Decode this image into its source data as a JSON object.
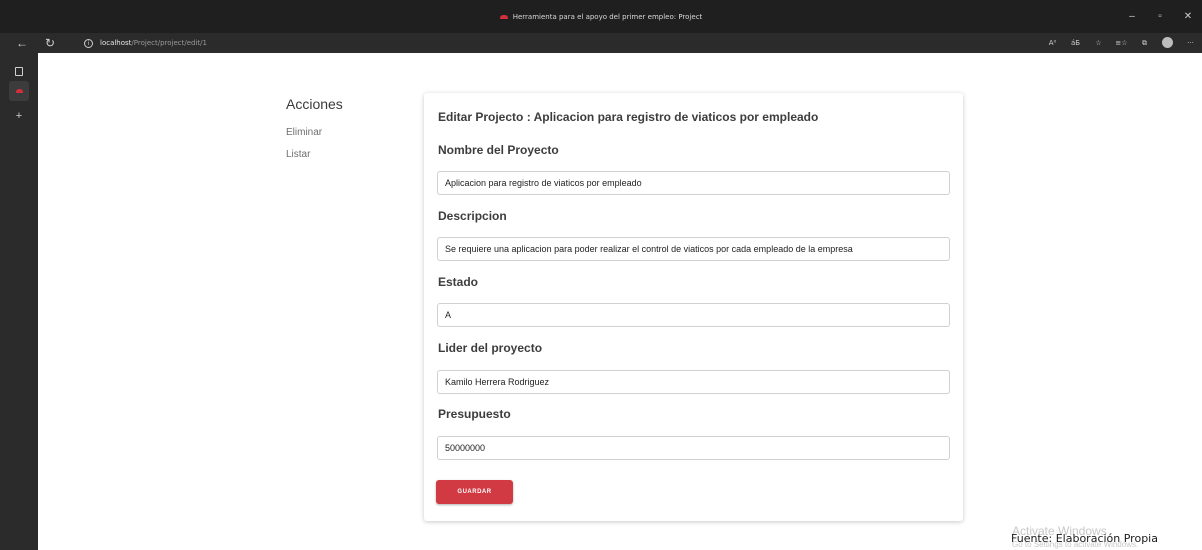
{
  "window": {
    "title": "Herramienta para el apoyo del primer empleo: Project",
    "controls": [
      "–",
      "▫",
      "✕"
    ]
  },
  "addressbar": {
    "back_icon": "←",
    "refresh_icon": "↻",
    "url_host": "localhost",
    "url_path": "/Project/project/edit/1",
    "tool_icons": [
      "A⁰",
      "áБ",
      "☆",
      "≡☆",
      "⧉"
    ],
    "more_icon": "···"
  },
  "sidebar": {
    "add_icon": "+"
  },
  "actions": {
    "title": "Acciones",
    "links": [
      "Eliminar",
      "Listar"
    ]
  },
  "form": {
    "title": "Editar Projecto : Aplicacion para registro de viaticos por empleado",
    "fields": [
      {
        "label": "Nombre del Proyecto",
        "value": "Aplicacion para registro de viaticos por empleado"
      },
      {
        "label": "Descripcion",
        "value": "Se requiere una aplicacion para poder realizar el control de viaticos por cada empleado de la empresa"
      },
      {
        "label": "Estado",
        "value": "A"
      },
      {
        "label": "Lider del proyecto",
        "value": "Kamilo Herrera Rodriguez"
      },
      {
        "label": "Presupuesto",
        "value": "50000000"
      }
    ],
    "save_label": "GUARDAR"
  },
  "watermark": {
    "title": "Activate Windows",
    "subtitle": "Go to Settings to activate Windows."
  },
  "caption": "Fuente: Elaboración Propia",
  "colors": {
    "accent": "#d23a43",
    "browser_chrome": "#1f1f1f"
  }
}
